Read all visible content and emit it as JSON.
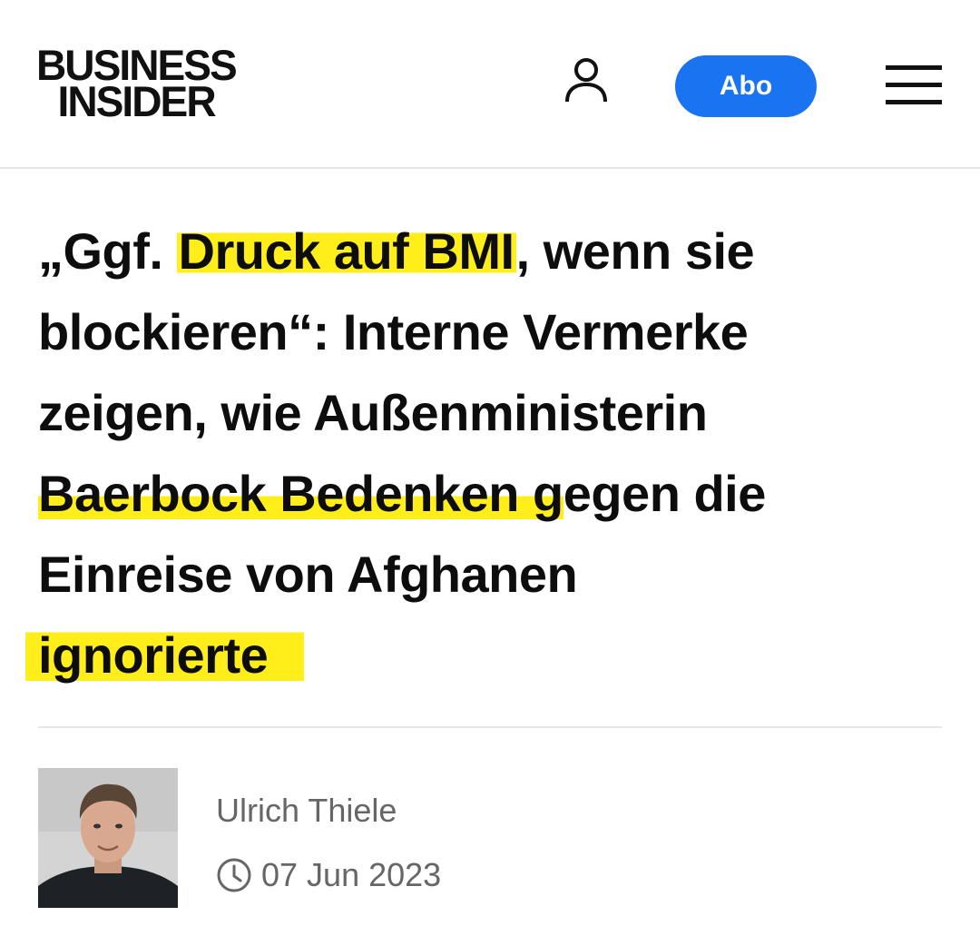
{
  "header": {
    "logo_line1": "BUSINESS",
    "logo_line2": "INSIDER",
    "abo_label": "Abo",
    "accent_color": "#1a73f0"
  },
  "headline": {
    "row1_pre": "„Ggf. ",
    "row1_hl": "Druck auf BMI",
    "row1_post": ", wenn sie",
    "row2": "blockieren“: Interne Vermerke",
    "row3": "zeigen, wie Außenministerin",
    "row4_hl": "Baerbock Bedenken g",
    "row4_post": "egen die",
    "row5": "Einreise von Afghanen",
    "row6_hl": "ignorierte",
    "highlight_color": "#ffee1a"
  },
  "author": {
    "name": "Ulrich Thiele",
    "date": "07 Jun 2023"
  },
  "icons": {
    "user": "user-icon",
    "menu": "menu-icon",
    "clock": "clock-icon"
  }
}
